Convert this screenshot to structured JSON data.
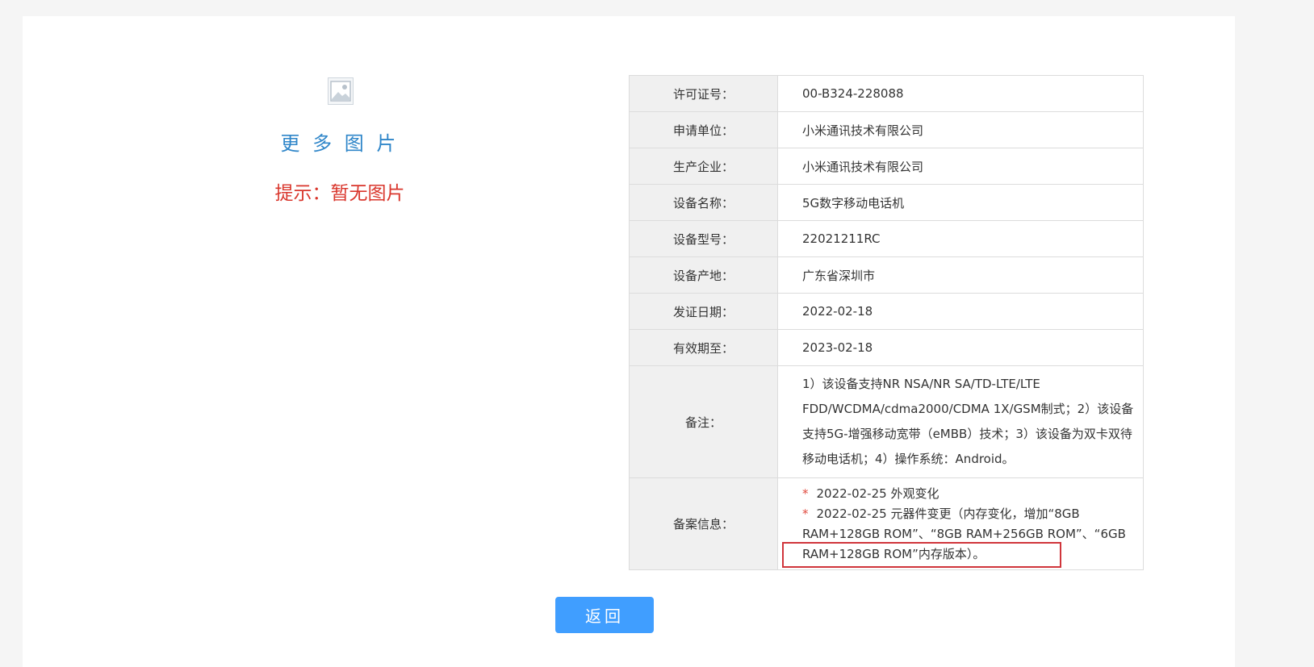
{
  "left": {
    "image_icon": "image-placeholder-icon",
    "more_images": "更 多 图 片",
    "hint": "提示：暂无图片"
  },
  "table": {
    "rows": [
      {
        "label": "许可证号：",
        "value": "00-B324-228088"
      },
      {
        "label": "申请单位：",
        "value": "小米通讯技术有限公司"
      },
      {
        "label": "生产企业：",
        "value": "小米通讯技术有限公司"
      },
      {
        "label": "设备名称：",
        "value": "5G数字移动电话机"
      },
      {
        "label": "设备型号：",
        "value": "22021211RC"
      },
      {
        "label": "设备产地：",
        "value": "广东省深圳市"
      },
      {
        "label": "发证日期：",
        "value": "2022-02-18"
      },
      {
        "label": "有效期至：",
        "value": "2023-02-18"
      }
    ],
    "remarks": {
      "label": "备注：",
      "value": "1）该设备支持NR NSA/NR SA/TD-LTE/LTE FDD/WCDMA/cdma2000/CDMA 1X/GSM制式；2）该设备支持5G-增强移动宽带（eMBB）技术；3）该设备为双卡双待移动电话机；4）操作系统：Android。"
    },
    "records": {
      "label": "备案信息：",
      "items": [
        {
          "marker": "*",
          "text": "2022-02-25 外观变化"
        },
        {
          "marker": "*",
          "text": "2022-02-25 元器件变更（内存变化，增加“8GB RAM+128GB ROM”、“8GB RAM+256GB ROM”、“6GB RAM+128GB ROM”内存版本）。"
        }
      ],
      "highlight_color": "#d0353b"
    }
  },
  "back_button": "返回",
  "colors": {
    "accent_blue": "#409eff",
    "link_blue": "#2f86c9",
    "hint_red": "#d9362c",
    "label_bg": "#f0f0f0"
  }
}
